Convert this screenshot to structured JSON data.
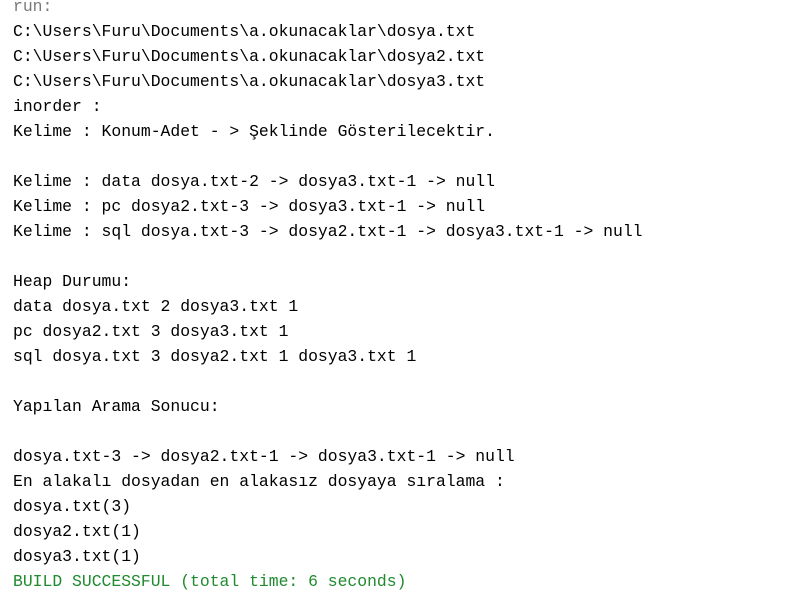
{
  "console": {
    "lines": [
      {
        "text": "run:",
        "style": "muted"
      },
      {
        "text": "C:\\Users\\Furu\\Documents\\a.okunacaklar\\dosya.txt",
        "style": "normal"
      },
      {
        "text": "C:\\Users\\Furu\\Documents\\a.okunacaklar\\dosya2.txt",
        "style": "normal"
      },
      {
        "text": "C:\\Users\\Furu\\Documents\\a.okunacaklar\\dosya3.txt",
        "style": "normal"
      },
      {
        "text": "inorder :",
        "style": "normal"
      },
      {
        "text": "Kelime : Konum-Adet - > Şeklinde Gösterilecektir.",
        "style": "normal"
      },
      {
        "text": "",
        "style": "empty"
      },
      {
        "text": "Kelime : data dosya.txt-2 -> dosya3.txt-1 -> null",
        "style": "normal"
      },
      {
        "text": "Kelime : pc dosya2.txt-3 -> dosya3.txt-1 -> null",
        "style": "normal"
      },
      {
        "text": "Kelime : sql dosya.txt-3 -> dosya2.txt-1 -> dosya3.txt-1 -> null",
        "style": "normal"
      },
      {
        "text": "",
        "style": "empty"
      },
      {
        "text": "Heap Durumu:",
        "style": "normal"
      },
      {
        "text": "data dosya.txt 2 dosya3.txt 1",
        "style": "normal"
      },
      {
        "text": "pc dosya2.txt 3 dosya3.txt 1",
        "style": "normal"
      },
      {
        "text": "sql dosya.txt 3 dosya2.txt 1 dosya3.txt 1",
        "style": "normal"
      },
      {
        "text": "",
        "style": "empty"
      },
      {
        "text": "Yapılan Arama Sonucu:",
        "style": "normal"
      },
      {
        "text": "",
        "style": "empty"
      },
      {
        "text": "dosya.txt-3 -> dosya2.txt-1 -> dosya3.txt-1 -> null",
        "style": "normal"
      },
      {
        "text": "En alakalı dosyadan en alakasız dosyaya sıralama :",
        "style": "normal"
      },
      {
        "text": "dosya.txt(3)",
        "style": "normal"
      },
      {
        "text": "dosya2.txt(1)",
        "style": "normal"
      },
      {
        "text": "dosya3.txt(1)",
        "style": "normal"
      },
      {
        "text": "BUILD SUCCESSFUL (total time: 6 seconds)",
        "style": "success"
      }
    ]
  },
  "colors": {
    "background": "#ffffff",
    "text": "#000000",
    "muted": "#7a7a7a",
    "success": "#1f8a2e"
  }
}
